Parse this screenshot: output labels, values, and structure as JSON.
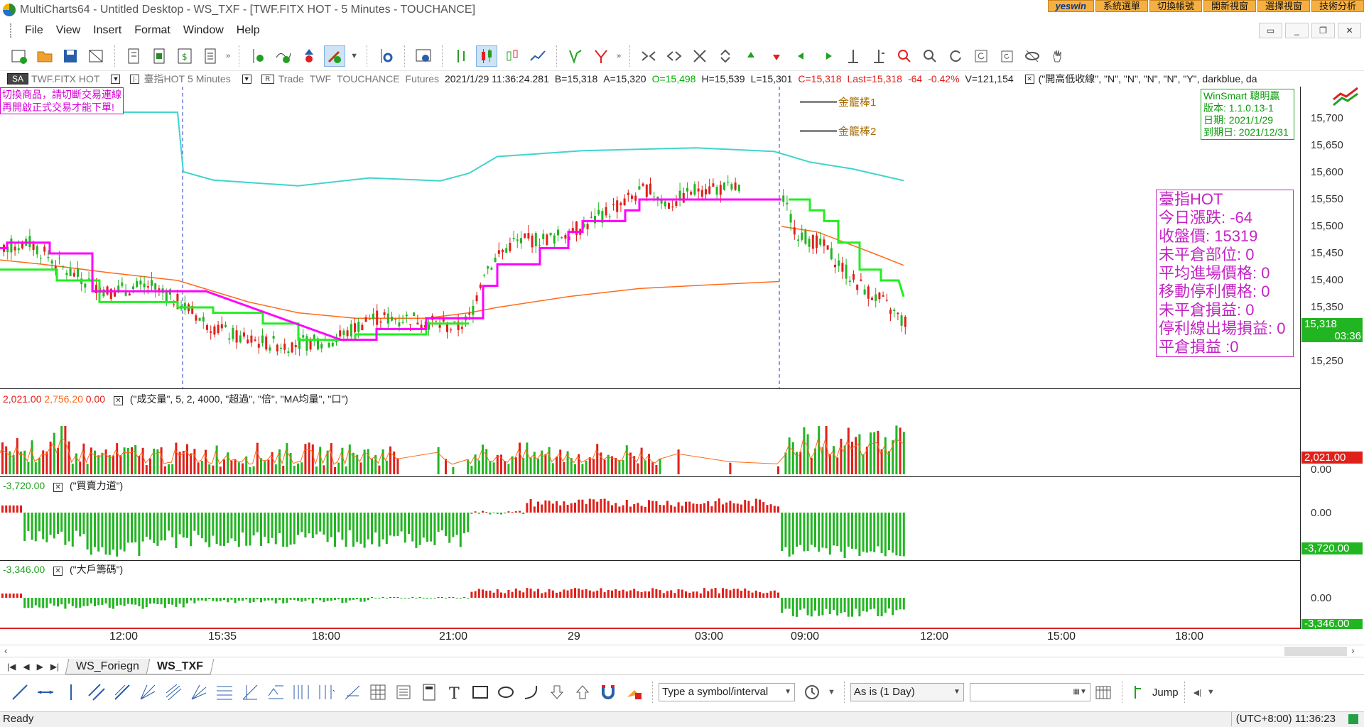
{
  "window": {
    "title": "MultiCharts64 - Untitled Desktop - WS_TXF - [TWF.FITX HOT - 5 Minutes - TOUCHANCE]",
    "plugin_tabs": [
      "yeswin",
      "系統選單",
      "切換帳號",
      "開新視窗",
      "選擇視窗",
      "技術分析"
    ]
  },
  "menu": {
    "items": [
      "File",
      "View",
      "Insert",
      "Format",
      "Window",
      "Help"
    ]
  },
  "status_line": {
    "sa": "SA",
    "symbol": "TWF.FITX HOT",
    "series": "臺指HOT",
    "interval": "5 Minutes",
    "r_box": "R",
    "trade": "Trade",
    "exchange": "TWF",
    "source": "TOUCHANCE",
    "category": "Futures",
    "datetime": "2021/1/29   11:36:24.281",
    "bid": "B=15,318",
    "ask": "A=15,320",
    "open": "O=15,498",
    "high": "H=15,539",
    "low": "L=15,301",
    "close": "C=15,318",
    "last": "Last=15,318",
    "change": "-64",
    "change_pct": "-0.42%",
    "volume": "V=121,154",
    "study": "(\"開高低收線\", \"N\", \"N\", \"N\", \"N\", \"Y\", darkblue, da"
  },
  "overlays": {
    "warning": [
      "切換商品，請切斷交易連線",
      "再開啟正式交易才能下單!"
    ],
    "legend": [
      "金籠棒1",
      "金籠棒2"
    ],
    "winsmart": [
      "WinSmart 聰明贏",
      "版本: 1.1.0.13-1",
      "日期: 2021/1/29",
      "到期日: 2021/12/31"
    ],
    "info": [
      "臺指HOT",
      "今日漲跌: -64",
      "收盤價: 15319",
      "未平倉部位: 0",
      "平均進場價格: 0",
      "移動停利價格: 0",
      "未平倉損益: 0",
      "停利線出場損益: 0",
      "平倉損益 :0"
    ]
  },
  "price_axis": {
    "ticks": [
      "15,700",
      "15,650",
      "15,600",
      "15,550",
      "15,500",
      "15,450",
      "15,400",
      "15,350",
      "15,300",
      "15,250"
    ],
    "last_tag": "15,318",
    "time_tag": "03:36"
  },
  "volume_pane": {
    "v1": "2,021.00",
    "v2": "2,756.20",
    "v3": "0.00",
    "study": "(\"成交量\", 5, 2, 4000, \"超過\", \"倍\", \"MA均量\", \"口\")",
    "tag": "2,021.00",
    "zero": "0.00"
  },
  "force_pane": {
    "value": "-3,720.00",
    "study": "(\"買賣力道\")",
    "zero": "0.00",
    "tag": "-3,720.00"
  },
  "big_pane": {
    "value": "-3,346.00",
    "study": "(\"大戶籌碼\")",
    "zero": "0.00",
    "tag": "-3,346.00"
  },
  "time_axis": {
    "labels": [
      "12:00",
      "15:35",
      "18:00",
      "21:00",
      "29",
      "03:00",
      "09:00",
      "12:00",
      "15:00",
      "18:00"
    ]
  },
  "workspace_tabs": [
    "WS_Foriegn",
    "WS_TXF"
  ],
  "drawbar": {
    "symbol_placeholder": "Type a symbol/interval",
    "range": "As is (1 Day)",
    "jump": "Jump"
  },
  "statusbar": {
    "left": "Ready",
    "right": "(UTC+8:00) 11:36:23"
  },
  "colors": {
    "up": "#e0201a",
    "down": "#22b522",
    "cyan": "#40d4cc",
    "magenta": "#ff00ff",
    "orange": "#ff6a1a",
    "stop_green": "#22ee22",
    "info": "#c424c4"
  }
}
